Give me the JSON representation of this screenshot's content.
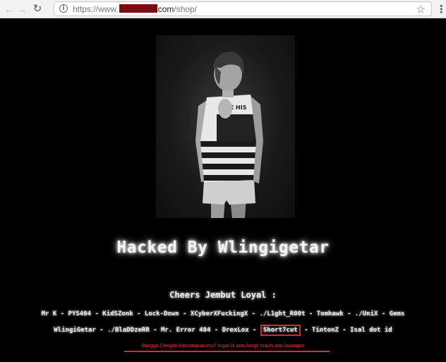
{
  "browser": {
    "url_prefix": "https://www.",
    "url_domain": "com",
    "url_path": "/shop/",
    "back_icon": "back-arrow-icon",
    "forward_icon": "forward-arrow-icon",
    "reload_icon": "reload-icon",
    "info_icon": "info-icon",
    "star_icon": "star-icon",
    "menu_icon": "kebab-menu-icon"
  },
  "page": {
    "title": "Hacked By Wlingigetar",
    "cheers": "Cheers Jembut Loyal  :",
    "line1": "Mr K - PYS404 - KidSZonk - Lock-Down - XCyberXFuckingX - ./L1ght_R00t - Tomhawk - ./UniX  - Gems",
    "line2_before": "WlingiGetar - ./BlaDDzeRR - Mr. Error 404 - DrexLox - ",
    "line2_highlight": "Short7cut",
    "line2_after": " - TintonZ - Isal dot id",
    "red_message": "Bangga Dengan Kemampuanmu? Ingat Di atas langit masih ada layangan",
    "highlight_color": "#d42b2b"
  }
}
